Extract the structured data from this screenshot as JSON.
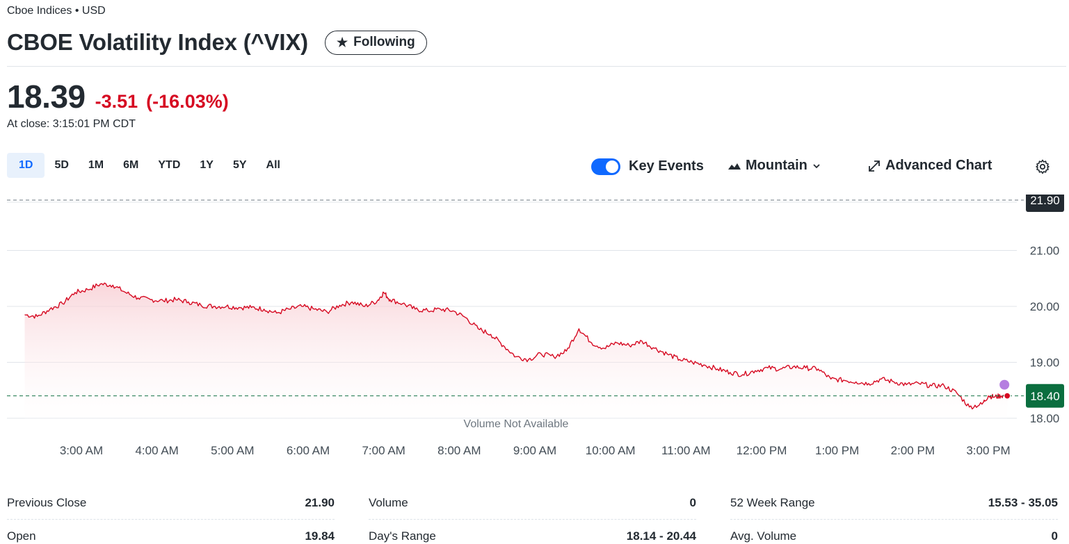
{
  "header": {
    "exchange_line": "Cboe Indices • USD",
    "title": "CBOE Volatility Index (^VIX)",
    "follow_label": "Following",
    "follow_icon": "star-icon"
  },
  "quote": {
    "price": "18.39",
    "change": "-3.51",
    "change_pct": "(-16.03%)",
    "close_time": "At close: 3:15:01 PM CDT",
    "colors": {
      "negative": "#d60a22",
      "accent": "#0f69ff",
      "current_tag": "#0b6e3f",
      "prev_tag": "#232a31"
    }
  },
  "range_tabs": [
    "1D",
    "5D",
    "1M",
    "6M",
    "YTD",
    "1Y",
    "5Y",
    "All"
  ],
  "active_range": "1D",
  "chart_controls": {
    "key_events_label": "Key Events",
    "key_events_on": true,
    "chart_type_label": "Mountain",
    "advanced_label": "Advanced Chart",
    "settings_icon": "gear-icon"
  },
  "chart_data": {
    "type": "area",
    "x_ticks": [
      "3:00 AM",
      "4:00 AM",
      "5:00 AM",
      "6:00 AM",
      "7:00 AM",
      "8:00 AM",
      "9:00 AM",
      "10:00 AM",
      "11:00 AM",
      "12:00 PM",
      "1:00 PM",
      "2:00 PM",
      "3:00 PM"
    ],
    "y_ticks": [
      "21.00",
      "20.00",
      "19.00",
      "18.00"
    ],
    "ylim": [
      17.9,
      22.0
    ],
    "previous_close_tag": "21.90",
    "previous_close": 21.9,
    "current_tag": "18.40",
    "current": 18.4,
    "volume_note": "Volume Not Available",
    "series": [
      {
        "x": [
          "2:15 AM",
          "2:25 AM",
          "2:35 AM",
          "2:45 AM",
          "2:55 AM",
          "3:05 AM",
          "3:15 AM",
          "3:25 AM",
          "3:35 AM",
          "3:45 AM",
          "3:55 AM",
          "4:05 AM",
          "4:15 AM",
          "4:25 AM",
          "4:35 AM",
          "4:45 AM",
          "4:55 AM",
          "5:05 AM",
          "5:15 AM",
          "5:25 AM",
          "5:35 AM",
          "5:45 AM",
          "5:55 AM",
          "6:05 AM",
          "6:15 AM",
          "6:25 AM",
          "6:35 AM",
          "6:45 AM",
          "6:55 AM",
          "7:00 AM",
          "7:05 AM",
          "7:15 AM",
          "7:25 AM",
          "7:35 AM",
          "7:45 AM",
          "7:55 AM",
          "8:05 AM",
          "8:15 AM",
          "8:25 AM",
          "8:35 AM",
          "8:45 AM",
          "8:55 AM",
          "9:05 AM",
          "9:15 AM",
          "9:25 AM",
          "9:35 AM",
          "9:45 AM",
          "9:55 AM",
          "10:05 AM",
          "10:15 AM",
          "10:25 AM",
          "10:35 AM",
          "10:45 AM",
          "10:55 AM",
          "11:05 AM",
          "11:15 AM",
          "11:25 AM",
          "11:35 AM",
          "11:45 AM",
          "11:55 AM",
          "12:05 PM",
          "12:15 PM",
          "12:25 PM",
          "12:35 PM",
          "12:45 PM",
          "12:55 PM",
          "1:05 PM",
          "1:15 PM",
          "1:25 PM",
          "1:35 PM",
          "1:45 PM",
          "1:55 PM",
          "2:05 PM",
          "2:15 PM",
          "2:25 PM",
          "2:35 PM",
          "2:45 PM",
          "2:55 PM",
          "3:00 PM",
          "3:05 PM",
          "3:10 PM",
          "3:15 PM"
        ],
        "values": [
          19.85,
          19.82,
          19.95,
          20.05,
          20.25,
          20.3,
          20.4,
          20.38,
          20.25,
          20.15,
          20.12,
          20.1,
          20.12,
          20.08,
          20.02,
          20.0,
          20.0,
          19.98,
          19.98,
          19.95,
          19.88,
          19.95,
          20.0,
          19.95,
          19.9,
          20.02,
          20.08,
          20.0,
          20.1,
          20.25,
          20.12,
          20.05,
          19.95,
          19.92,
          19.95,
          19.92,
          19.8,
          19.6,
          19.5,
          19.3,
          19.1,
          19.05,
          19.15,
          19.1,
          19.2,
          19.6,
          19.35,
          19.25,
          19.35,
          19.3,
          19.38,
          19.25,
          19.15,
          19.05,
          19.0,
          18.95,
          18.88,
          18.82,
          18.78,
          18.85,
          18.9,
          18.88,
          18.92,
          18.9,
          18.88,
          18.7,
          18.68,
          18.65,
          18.62,
          18.7,
          18.65,
          18.6,
          18.62,
          18.58,
          18.58,
          18.45,
          18.2,
          18.25,
          18.4,
          18.38,
          18.4,
          18.4
        ]
      }
    ]
  },
  "stats": [
    [
      {
        "label": "Previous Close",
        "value": "21.90"
      },
      {
        "label": "Open",
        "value": "19.84"
      }
    ],
    [
      {
        "label": "Volume",
        "value": "0"
      },
      {
        "label": "Day's Range",
        "value": "18.14 - 20.44"
      }
    ],
    [
      {
        "label": "52 Week Range",
        "value": "15.53 - 35.05"
      },
      {
        "label": "Avg. Volume",
        "value": "0"
      }
    ]
  ]
}
